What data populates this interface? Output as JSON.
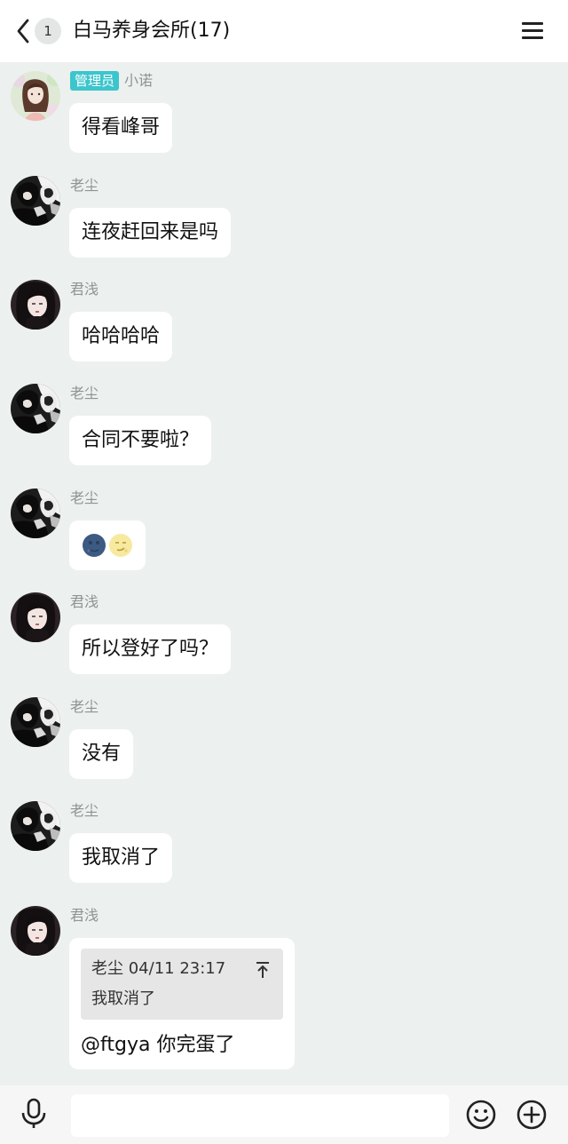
{
  "header": {
    "unread_count": "1",
    "title": "白马养身会所(17)"
  },
  "messages": [
    {
      "role": "管理员",
      "name": "小诺",
      "text": "得看峰哥",
      "avatar": "avatar-xiaonuo"
    },
    {
      "name": "老尘",
      "text": "连夜赶回来是吗",
      "avatar": "avatar-laochen"
    },
    {
      "name": "君浅",
      "text": "哈哈哈哈",
      "avatar": "avatar-junqian"
    },
    {
      "name": "老尘",
      "text": "合同不要啦？",
      "avatar": "avatar-laochen"
    },
    {
      "name": "老尘",
      "emojis": [
        "new-moon-face-icon",
        "full-moon-face-icon"
      ],
      "avatar": "avatar-laochen"
    },
    {
      "name": "君浅",
      "text": "所以登好了吗？",
      "avatar": "avatar-junqian"
    },
    {
      "name": "老尘",
      "text": "没有",
      "avatar": "avatar-laochen"
    },
    {
      "name": "老尘",
      "text": "我取消了",
      "avatar": "avatar-laochen"
    },
    {
      "name": "君浅",
      "avatar": "avatar-junqian",
      "quote": {
        "author_time": "老尘 04/11 23:17",
        "text": "我取消了"
      },
      "text": "@ftgya 你完蛋了"
    }
  ],
  "bottom_bar": {
    "input_value": "",
    "icons": [
      "microphone-icon",
      "emoji-icon",
      "plus-icon"
    ]
  },
  "colors": {
    "role_badge": "#3cc5cc",
    "background": "#ecf0ee",
    "bubble": "#ffffff"
  }
}
